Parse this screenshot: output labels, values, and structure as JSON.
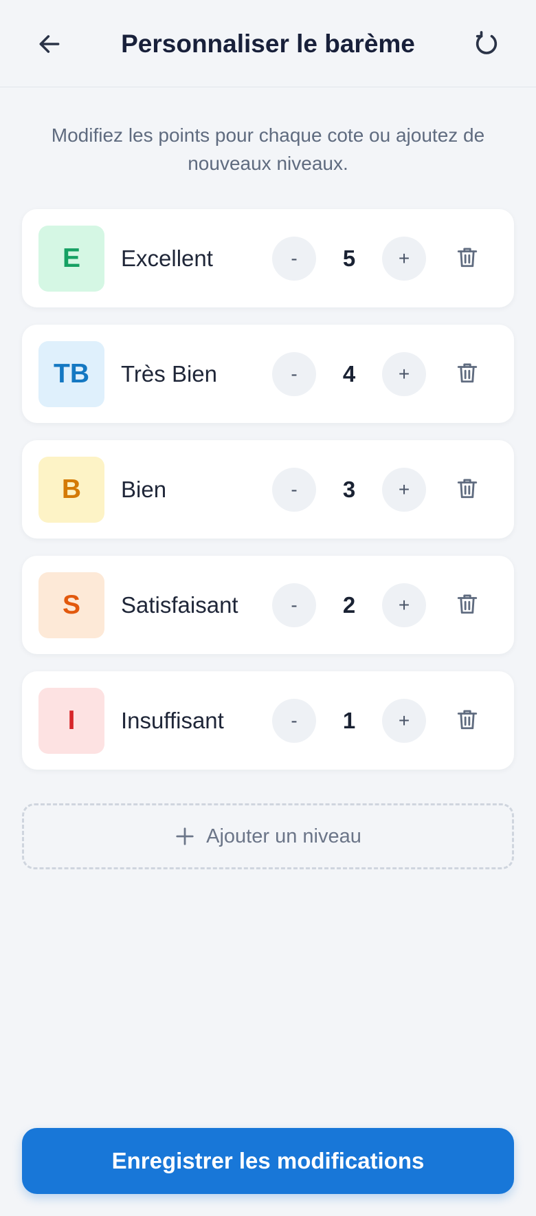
{
  "header": {
    "title": "Personnaliser le barème",
    "back_icon": "arrow-left-icon",
    "reset_icon": "refresh-icon"
  },
  "subtitle": "Modifiez les points pour chaque cote ou ajoutez de nouveaux niveaux.",
  "levels": [
    {
      "code": "E",
      "name": "Excellent",
      "points": "5",
      "badge_bg": "#d5f7e4",
      "badge_fg": "#16a163"
    },
    {
      "code": "TB",
      "name": "Très Bien",
      "points": "4",
      "badge_bg": "#dff0fc",
      "badge_fg": "#1478c2"
    },
    {
      "code": "B",
      "name": "Bien",
      "points": "3",
      "badge_bg": "#fdf3c6",
      "badge_fg": "#d47a06"
    },
    {
      "code": "S",
      "name": "Satisfaisant",
      "points": "2",
      "badge_bg": "#fde9d7",
      "badge_fg": "#e2590d"
    },
    {
      "code": "I",
      "name": "Insuffisant",
      "points": "1",
      "badge_bg": "#fde2e2",
      "badge_fg": "#d6262a"
    }
  ],
  "stepper": {
    "minus_label": "-",
    "plus_label": "+"
  },
  "add_level": {
    "label": "Ajouter un niveau",
    "icon": "plus-icon"
  },
  "save": {
    "label": "Enregistrer les modifications"
  },
  "colors": {
    "primary": "#1877d8",
    "background": "#f3f5f8",
    "icon": "#5f6b7f"
  }
}
